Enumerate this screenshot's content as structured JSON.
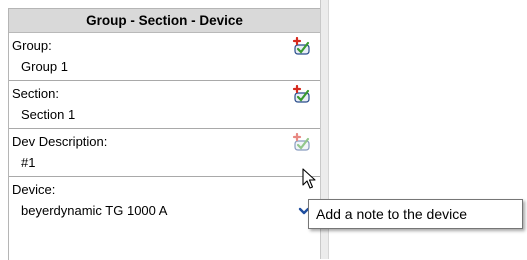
{
  "panel": {
    "title": "Group - Section - Device",
    "fields": [
      {
        "label": "Group:",
        "value": "Group 1",
        "button_icon": "add-note-icon"
      },
      {
        "label": "Section:",
        "value": "Section 1",
        "button_icon": "add-note-icon"
      },
      {
        "label": "Dev Description:",
        "value": "#1",
        "button_icon": "add-note-icon"
      },
      {
        "label": "Device:",
        "value": "beyerdynamic TG 1000 A",
        "button_icon": "chevron-down-icon"
      }
    ]
  },
  "tooltip": {
    "text": "Add a note to the device"
  },
  "colors": {
    "header_bg": "#d9d9d9",
    "chevron": "#1f4e9e",
    "note_red": "#d62a1e",
    "note_green": "#3a9a2e"
  }
}
